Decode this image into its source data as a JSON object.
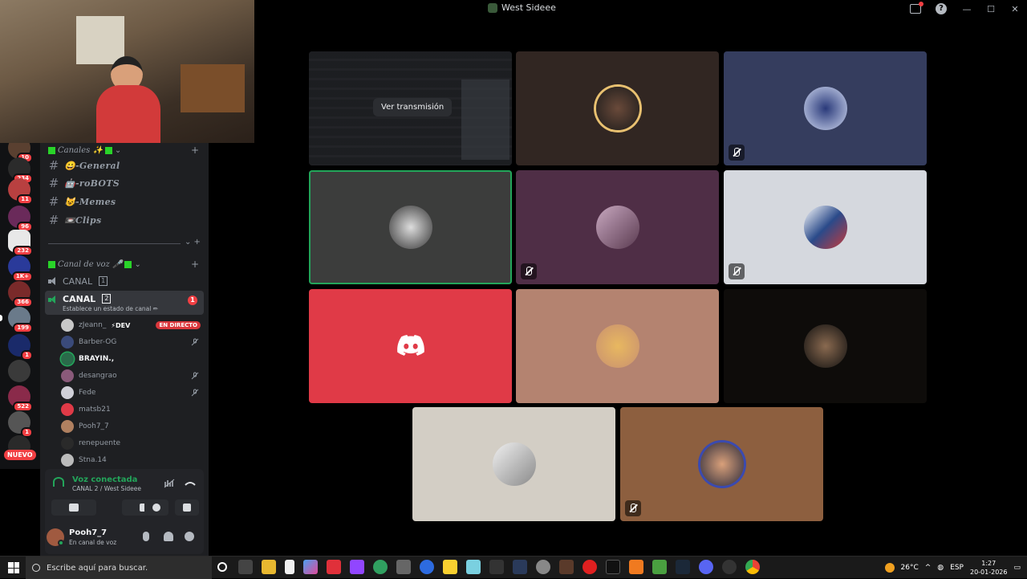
{
  "window": {
    "title": "West Sideee"
  },
  "servers": [
    {
      "badge": "10"
    },
    {
      "badge": "234"
    },
    {
      "badge": "11"
    },
    {
      "badge": "96"
    },
    {
      "badge": "232"
    },
    {
      "badge": "1K+"
    },
    {
      "badge": "366"
    },
    {
      "badge": "199"
    },
    {
      "badge": "1"
    },
    {
      "badge": ""
    },
    {
      "badge": "522"
    },
    {
      "badge": "1"
    }
  ],
  "new_label": "NUEVO",
  "sidebar": {
    "text_category": "Canales ✨",
    "text_channels": [
      "😀-General",
      "🤖-roBOTS",
      "😺-Memes",
      "📼Clips"
    ],
    "voice_category": "Canal de voz 🎤",
    "voice_channels": [
      {
        "name": "CANAL",
        "num": "1"
      },
      {
        "name": "CANAL",
        "num": "2",
        "unread": "1",
        "status": "Establece un estado de canal ✏"
      }
    ],
    "members": [
      {
        "name": "zJeann_",
        "tag": "⚡DEV",
        "live": "EN DIRECTO"
      },
      {
        "name": "Barber-OG"
      },
      {
        "name": "BRAYIN.,"
      },
      {
        "name": "desangrao"
      },
      {
        "name": "Fede"
      },
      {
        "name": "matsb21"
      },
      {
        "name": "Pooh7_7"
      },
      {
        "name": "renepuente"
      },
      {
        "name": "Stna.14"
      }
    ]
  },
  "voice_panel": {
    "status": "Voz conectada",
    "location": "CANAL 2 / West Sideee"
  },
  "user_panel": {
    "username": "Pooh7_7",
    "status": "En canal de voz"
  },
  "stream": {
    "watch_label": "Ver transmisión"
  },
  "taskbar": {
    "search_placeholder": "Escribe aquí para buscar.",
    "temperature": "26°C",
    "language": "ESP",
    "time": "1:27",
    "date": "20-01-2026"
  },
  "colors": {
    "accent_green": "#23a55a",
    "danger_red": "#da373c",
    "discord_tile": "#e03a47"
  }
}
